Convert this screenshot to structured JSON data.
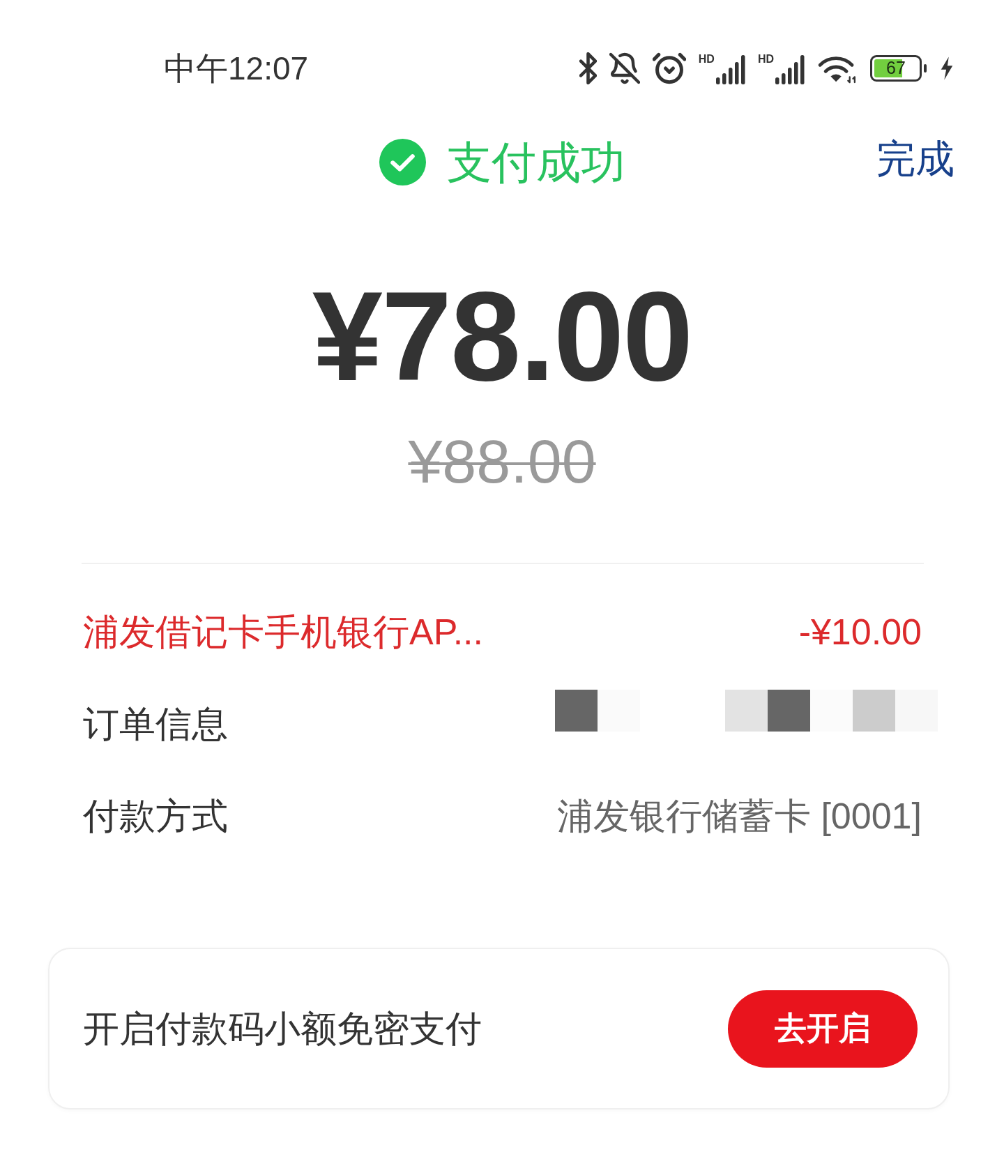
{
  "status_bar": {
    "time": "中午12:07",
    "signals": [
      {
        "network_type": "HD"
      },
      {
        "network_type": "HD"
      }
    ],
    "battery_percent": "67"
  },
  "header": {
    "title": "支付成功",
    "done_button": "完成"
  },
  "amount": {
    "paid": "¥78.00",
    "original": "¥88.00"
  },
  "details": [
    {
      "kind": "discount",
      "label": "浦发借记卡手机银行AP...",
      "value": "-¥10.00"
    },
    {
      "kind": "redacted",
      "label": "订单信息"
    },
    {
      "kind": "plain",
      "label": "付款方式",
      "value": "浦发银行储蓄卡 [0001]"
    }
  ],
  "promo": {
    "text": "开启付款码小额免密支付",
    "button": "去开启"
  }
}
